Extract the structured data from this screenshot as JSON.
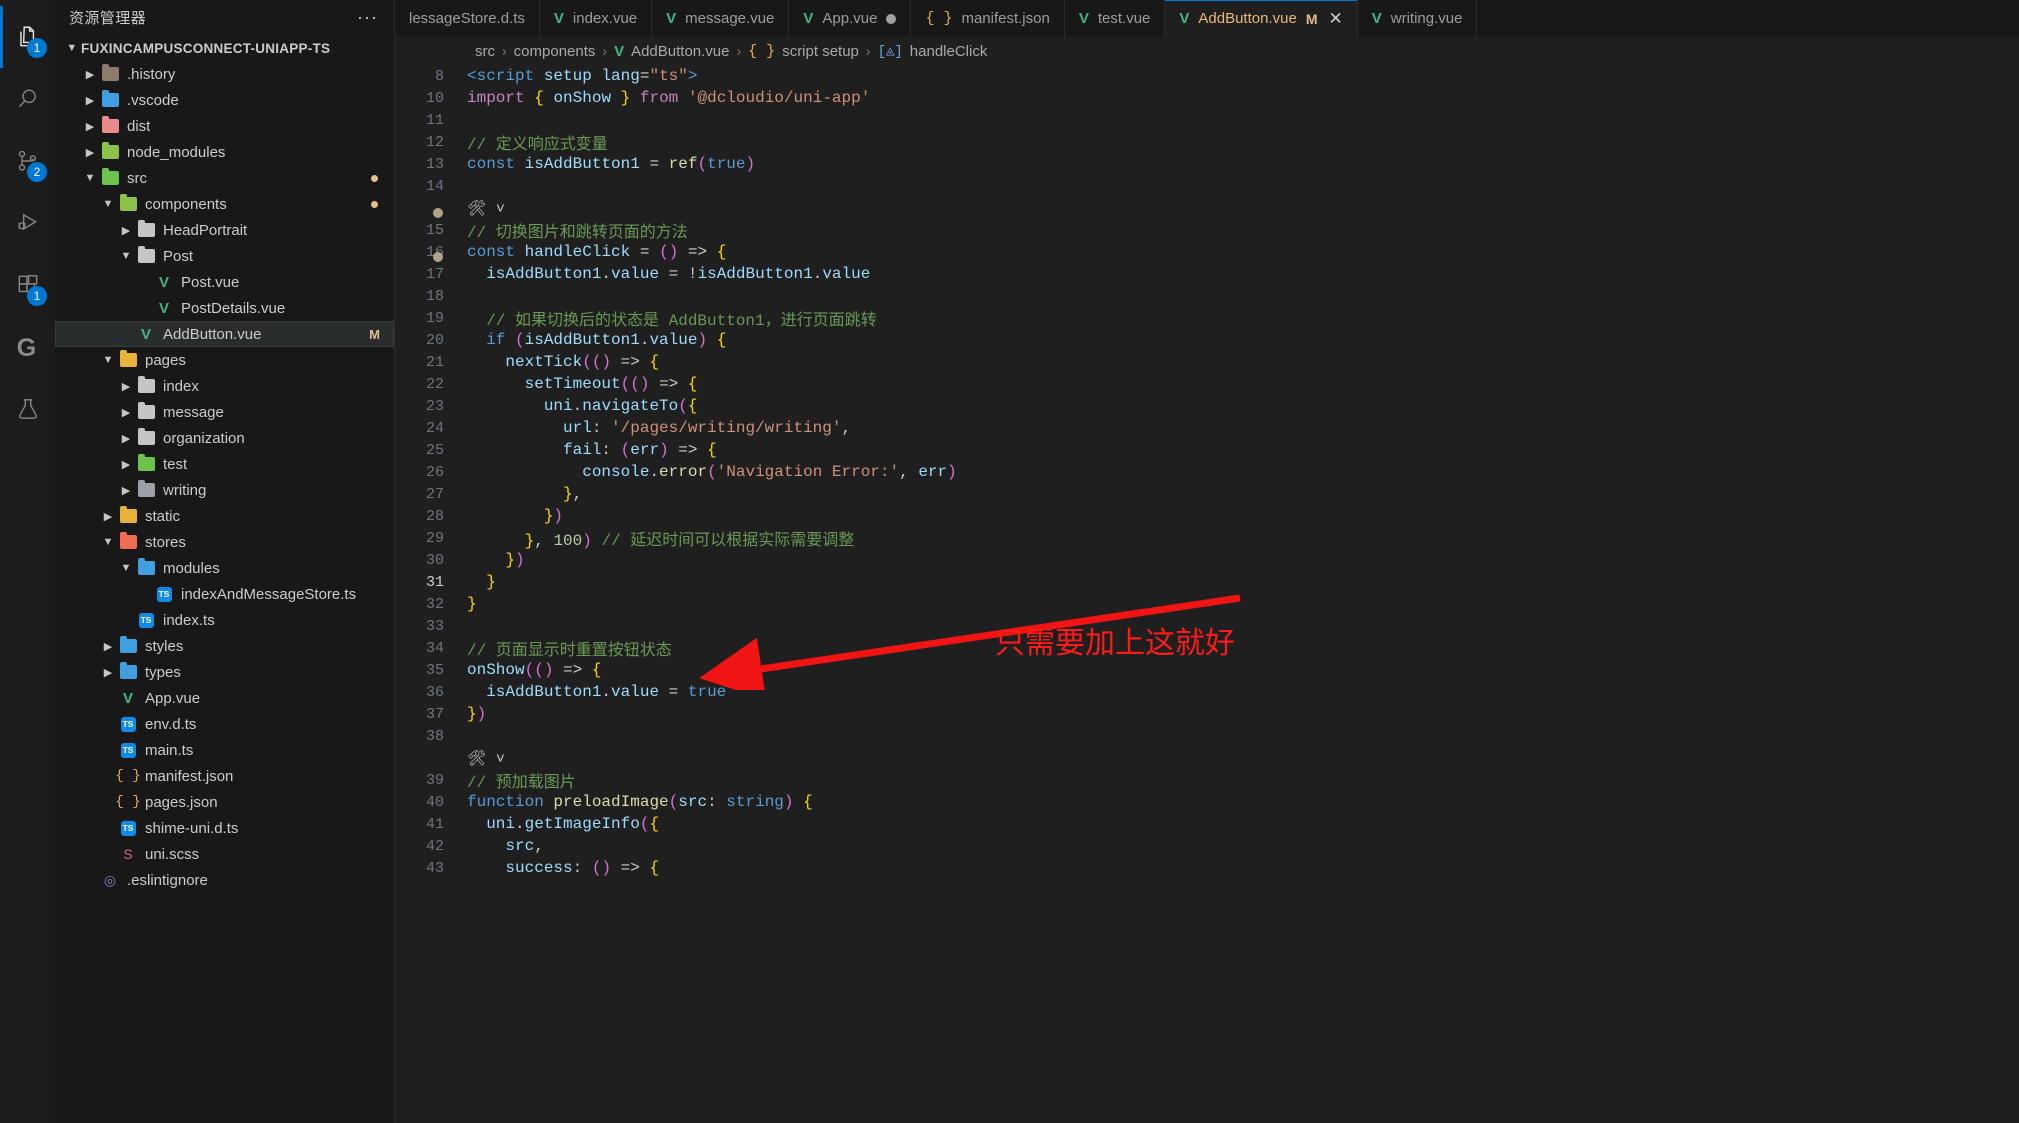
{
  "activitybar": {
    "items": [
      {
        "name": "explorer",
        "icon": "files-icon",
        "badge": "1",
        "active": true
      },
      {
        "name": "search",
        "icon": "search-icon",
        "badge": "",
        "active": false
      },
      {
        "name": "source-control",
        "icon": "source-control-icon",
        "badge": "2",
        "active": false
      },
      {
        "name": "run-and-debug",
        "icon": "debug-icon",
        "badge": "",
        "active": false
      },
      {
        "name": "extensions",
        "icon": "extensions-icon",
        "badge": "1",
        "active": false
      },
      {
        "name": "gitlens",
        "icon": "gitlens-g-icon",
        "badge": "",
        "active": false
      },
      {
        "name": "testing",
        "icon": "beaker-icon",
        "badge": "",
        "active": false
      }
    ]
  },
  "sidebar": {
    "title": "资源管理器",
    "more_actions": "···",
    "root": "FUXINCAMPUSCONNECT-UNIAPP-TS",
    "tree": [
      {
        "label": ".history",
        "depth": 1,
        "type": "folder",
        "twisty": "▶",
        "color": "#8d7b6b",
        "selected": false,
        "badge": ""
      },
      {
        "label": ".vscode",
        "depth": 1,
        "type": "folder",
        "twisty": "▶",
        "color": "#3f9fe0",
        "selected": false,
        "badge": ""
      },
      {
        "label": "dist",
        "depth": 1,
        "type": "folder",
        "twisty": "▶",
        "color": "#e98b8b",
        "selected": false,
        "badge": ""
      },
      {
        "label": "node_modules",
        "depth": 1,
        "type": "folder",
        "twisty": "▶",
        "color": "#8dc149",
        "selected": false,
        "badge": ""
      },
      {
        "label": "src",
        "depth": 1,
        "type": "folder",
        "twisty": "▼",
        "color": "#6cc24a",
        "selected": false,
        "badge": "dot"
      },
      {
        "label": "components",
        "depth": 2,
        "type": "folder",
        "twisty": "▼",
        "color": "#8dc149",
        "selected": false,
        "badge": "dot"
      },
      {
        "label": "HeadPortrait",
        "depth": 3,
        "type": "folder",
        "twisty": "▶",
        "color": "#c5c5c5",
        "selected": false,
        "badge": ""
      },
      {
        "label": "Post",
        "depth": 3,
        "type": "folder",
        "twisty": "▼",
        "color": "#c5c5c5",
        "selected": false,
        "badge": ""
      },
      {
        "label": "Post.vue",
        "depth": 4,
        "type": "vue",
        "twisty": "",
        "color": "#41b883",
        "selected": false,
        "badge": ""
      },
      {
        "label": "PostDetails.vue",
        "depth": 4,
        "type": "vue",
        "twisty": "",
        "color": "#41b883",
        "selected": false,
        "badge": ""
      },
      {
        "label": "AddButton.vue",
        "depth": 3,
        "type": "vue",
        "twisty": "",
        "color": "#41b883",
        "selected": true,
        "badge": "M"
      },
      {
        "label": "pages",
        "depth": 2,
        "type": "folder",
        "twisty": "▼",
        "color": "#e8b339",
        "selected": false,
        "badge": ""
      },
      {
        "label": "index",
        "depth": 3,
        "type": "folder",
        "twisty": "▶",
        "color": "#c5c5c5",
        "selected": false,
        "badge": ""
      },
      {
        "label": "message",
        "depth": 3,
        "type": "folder",
        "twisty": "▶",
        "color": "#c5c5c5",
        "selected": false,
        "badge": ""
      },
      {
        "label": "organization",
        "depth": 3,
        "type": "folder",
        "twisty": "▶",
        "color": "#c5c5c5",
        "selected": false,
        "badge": ""
      },
      {
        "label": "test",
        "depth": 3,
        "type": "folder",
        "twisty": "▶",
        "color": "#6cc24a",
        "selected": false,
        "badge": ""
      },
      {
        "label": "writing",
        "depth": 3,
        "type": "folder",
        "twisty": "▶",
        "color": "#9aa0a6",
        "selected": false,
        "badge": ""
      },
      {
        "label": "static",
        "depth": 2,
        "type": "folder",
        "twisty": "▶",
        "color": "#e8b339",
        "selected": false,
        "badge": ""
      },
      {
        "label": "stores",
        "depth": 2,
        "type": "folder",
        "twisty": "▼",
        "color": "#f26b53",
        "selected": false,
        "badge": ""
      },
      {
        "label": "modules",
        "depth": 3,
        "type": "folder",
        "twisty": "▼",
        "color": "#3f9fe0",
        "selected": false,
        "badge": ""
      },
      {
        "label": "indexAndMessageStore.ts",
        "depth": 4,
        "type": "ts",
        "twisty": "",
        "color": "#0f8ce9",
        "selected": false,
        "badge": ""
      },
      {
        "label": "index.ts",
        "depth": 3,
        "type": "ts",
        "twisty": "",
        "color": "#0f8ce9",
        "selected": false,
        "badge": ""
      },
      {
        "label": "styles",
        "depth": 2,
        "type": "folder",
        "twisty": "▶",
        "color": "#3f9fe0",
        "selected": false,
        "badge": ""
      },
      {
        "label": "types",
        "depth": 2,
        "type": "folder",
        "twisty": "▶",
        "color": "#3f9fe0",
        "selected": false,
        "badge": ""
      },
      {
        "label": "App.vue",
        "depth": 2,
        "type": "vue",
        "twisty": "",
        "color": "#41b883",
        "selected": false,
        "badge": ""
      },
      {
        "label": "env.d.ts",
        "depth": 2,
        "type": "ts",
        "twisty": "",
        "color": "#0f8ce9",
        "selected": false,
        "badge": ""
      },
      {
        "label": "main.ts",
        "depth": 2,
        "type": "ts",
        "twisty": "",
        "color": "#0f8ce9",
        "selected": false,
        "badge": ""
      },
      {
        "label": "manifest.json",
        "depth": 2,
        "type": "json",
        "twisty": "",
        "color": "#e8ab53",
        "selected": false,
        "badge": ""
      },
      {
        "label": "pages.json",
        "depth": 2,
        "type": "json",
        "twisty": "",
        "color": "#e8ab53",
        "selected": false,
        "badge": ""
      },
      {
        "label": "shime-uni.d.ts",
        "depth": 2,
        "type": "ts",
        "twisty": "",
        "color": "#0f8ce9",
        "selected": false,
        "badge": ""
      },
      {
        "label": "uni.scss",
        "depth": 2,
        "type": "scss",
        "twisty": "",
        "color": "#cf649a",
        "selected": false,
        "badge": ""
      },
      {
        "label": ".eslintignore",
        "depth": 1,
        "type": "eslint",
        "twisty": "",
        "color": "#8080c0",
        "selected": false,
        "badge": ""
      }
    ]
  },
  "tabs": [
    {
      "label": "lessageStore.d.ts",
      "icon": "ts-icon",
      "active": false,
      "dirty": false,
      "modified": "",
      "close": false
    },
    {
      "label": "index.vue",
      "icon": "vue-icon",
      "active": false,
      "dirty": false,
      "modified": "",
      "close": false
    },
    {
      "label": "message.vue",
      "icon": "vue-icon",
      "active": false,
      "dirty": false,
      "modified": "",
      "close": false
    },
    {
      "label": "App.vue",
      "icon": "vue-icon",
      "active": false,
      "dirty": true,
      "modified": "",
      "close": false
    },
    {
      "label": "manifest.json",
      "icon": "json-icon",
      "active": false,
      "dirty": false,
      "modified": "",
      "close": false
    },
    {
      "label": "test.vue",
      "icon": "vue-icon",
      "active": false,
      "dirty": false,
      "modified": "",
      "close": false
    },
    {
      "label": "AddButton.vue",
      "icon": "vue-icon",
      "active": true,
      "dirty": false,
      "modified": "M",
      "close": true
    },
    {
      "label": "writing.vue",
      "icon": "vue-icon",
      "active": false,
      "dirty": false,
      "modified": "",
      "close": false
    }
  ],
  "breadcrumb": [
    {
      "label": "src",
      "icon": ""
    },
    {
      "label": "components",
      "icon": ""
    },
    {
      "label": "AddButton.vue",
      "icon": "vue-icon"
    },
    {
      "label": "script setup",
      "icon": "json-icon"
    },
    {
      "label": "handleClick",
      "icon": "method-icon"
    }
  ],
  "code": {
    "lines": [
      {
        "num": "8",
        "text": "<script setup lang=\"ts\">"
      },
      {
        "num": "10",
        "text": "import { onShow } from '@dcloudio/uni-app'"
      },
      {
        "num": "11",
        "text": ""
      },
      {
        "num": "12",
        "text": "// 定义响应式变量"
      },
      {
        "num": "13",
        "text": "const isAddButton1 = ref(true)"
      },
      {
        "num": "14",
        "text": ""
      },
      {
        "num": "",
        "text": "codelens"
      },
      {
        "num": "15",
        "text": "// 切换图片和跳转页面的方法"
      },
      {
        "num": "16",
        "text": "const handleClick = () => {"
      },
      {
        "num": "17",
        "text": "  isAddButton1.value = !isAddButton1.value"
      },
      {
        "num": "18",
        "text": ""
      },
      {
        "num": "19",
        "text": "  // 如果切换后的状态是 AddButton1，进行页面跳转"
      },
      {
        "num": "20",
        "text": "  if (isAddButton1.value) {"
      },
      {
        "num": "21",
        "text": "    nextTick(() => {"
      },
      {
        "num": "22",
        "text": "      setTimeout(() => {"
      },
      {
        "num": "23",
        "text": "        uni.navigateTo({"
      },
      {
        "num": "24",
        "text": "          url: '/pages/writing/writing',"
      },
      {
        "num": "25",
        "text": "          fail: (err) => {"
      },
      {
        "num": "26",
        "text": "            console.error('Navigation Error:', err)"
      },
      {
        "num": "27",
        "text": "          },"
      },
      {
        "num": "28",
        "text": "        })"
      },
      {
        "num": "29",
        "text": "      }, 100) // 延迟时间可以根据实际需要调整"
      },
      {
        "num": "30",
        "text": "    })"
      },
      {
        "num": "31",
        "text": "  }"
      },
      {
        "num": "32",
        "text": "}"
      },
      {
        "num": "33",
        "text": ""
      },
      {
        "num": "34",
        "text": "// 页面显示时重置按钮状态"
      },
      {
        "num": "35",
        "text": "onShow(() => {"
      },
      {
        "num": "36",
        "text": "  isAddButton1.value = true"
      },
      {
        "num": "37",
        "text": "})"
      },
      {
        "num": "38",
        "text": ""
      },
      {
        "num": "",
        "text": "codelens"
      },
      {
        "num": "39",
        "text": "// 预加载图片"
      },
      {
        "num": "40",
        "text": "function preloadImage(src: string) {"
      },
      {
        "num": "41",
        "text": "  uni.getImageInfo({"
      },
      {
        "num": "42",
        "text": "    src,"
      },
      {
        "num": "43",
        "text": "    success: () => {"
      }
    ],
    "current_line_number": "31"
  },
  "annotation": {
    "text": "只需要加上这就好",
    "color": "#ff1a1a",
    "arrow": "red-arrow-pointing-left-down"
  }
}
